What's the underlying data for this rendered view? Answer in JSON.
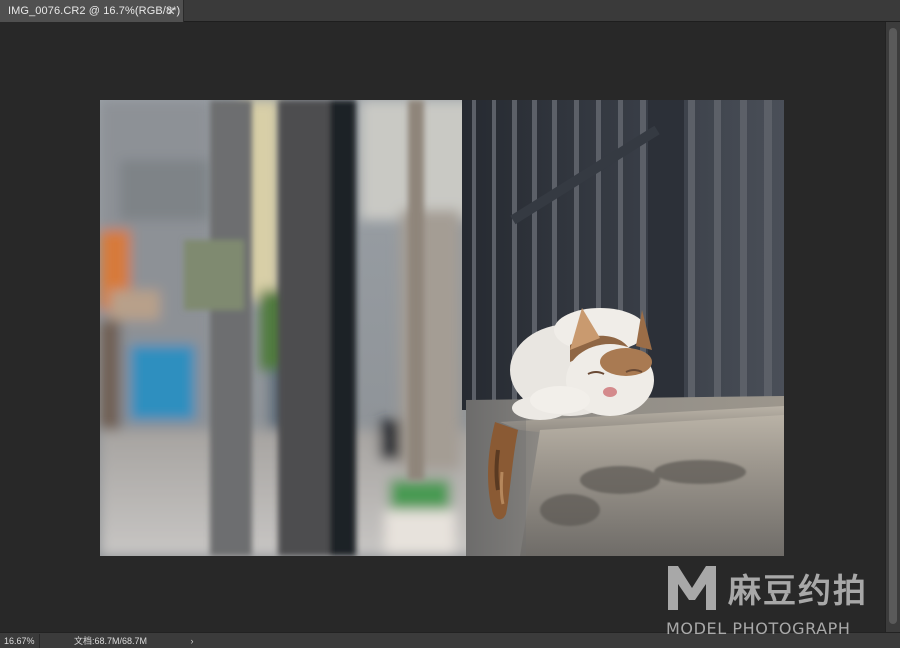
{
  "document_tab": {
    "title": "IMG_0076.CR2 @ 16.7%(RGB/8*)",
    "close_glyph": "✕"
  },
  "canvas": {
    "image_description_icon": "photo-canvas"
  },
  "status_bar": {
    "zoom": "16.67%",
    "doc_info": "文档:68.7M/68.7M",
    "arrow_glyph": "›"
  },
  "watermark": {
    "logo_letter": "M",
    "cn_text": "麻豆约拍",
    "en_text": "MODEL PHOTOGRAPH"
  },
  "colors": {
    "workspace_bg": "#282828",
    "tab_active": "#505050",
    "statusbar_bg": "#3b3b3b"
  }
}
